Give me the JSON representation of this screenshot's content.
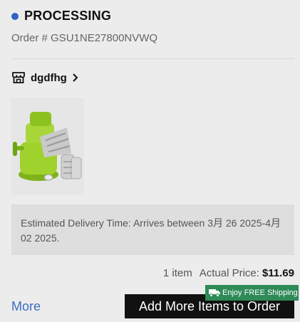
{
  "order": {
    "status": "PROCESSING",
    "status_color": "#2f64c4",
    "order_number": "Order # GSU1NE27800NVWQ"
  },
  "store": {
    "icon": "store-icon",
    "name": "dgdfhg",
    "chevron": "chevron-right-icon"
  },
  "product": {
    "image": "vegetable-slicer-product-image"
  },
  "delivery": {
    "text": "Estimated Delivery Time: Arrives between 3月 26 2025-4月 02 2025."
  },
  "summary": {
    "item_count": "1 item",
    "price_label": "Actual Price:",
    "price": "$11.69"
  },
  "actions": {
    "more_label": "More",
    "free_shipping_badge": "Enjoy FREE Shipping",
    "badge_icon": "truck-icon",
    "badge_color": "#2e8a57",
    "add_items_label": "Add More Items to Order"
  }
}
